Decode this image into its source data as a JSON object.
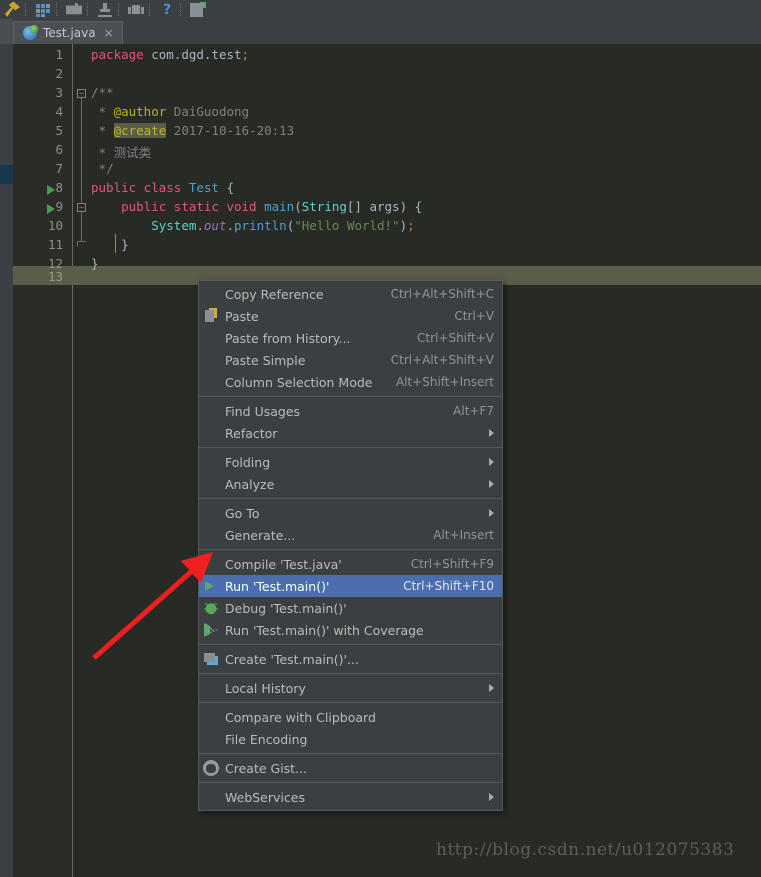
{
  "window": {
    "background_color": "#282a26",
    "chrome_color": "#3c4043"
  },
  "toolbar": {
    "icons": [
      {
        "name": "build-hammer-icon",
        "label": "Build"
      },
      {
        "name": "app-grid-icon",
        "label": "Android Resources"
      },
      {
        "name": "sync-gradle-icon",
        "label": "Sync Project"
      },
      {
        "name": "sdk-download-icon",
        "label": "SDK Manager"
      },
      {
        "name": "avd-manager-icon",
        "label": "AVD Manager"
      },
      {
        "name": "help-icon",
        "label": "Help"
      },
      {
        "name": "save-all-icon",
        "label": "Save All"
      }
    ]
  },
  "tab": {
    "icon": "java-class-icon",
    "label": "Test.java",
    "close": "×"
  },
  "editor": {
    "lines": [
      {
        "num": "1",
        "tokens": [
          {
            "t": "package",
            "c": "kw-pink"
          },
          {
            "t": " com.dgd.test",
            "c": "punct"
          },
          {
            "t": ";",
            "c": "semi"
          }
        ]
      },
      {
        "num": "2",
        "tokens": []
      },
      {
        "num": "3",
        "tokens": [
          {
            "t": "/**",
            "c": "cmt"
          }
        ]
      },
      {
        "num": "4",
        "tokens": [
          {
            "t": " * ",
            "c": "cmt"
          },
          {
            "t": "@author",
            "c": "anno"
          },
          {
            "t": " DaiGuodong",
            "c": "cmt"
          }
        ]
      },
      {
        "num": "5",
        "tokens": [
          {
            "t": " * ",
            "c": "cmt"
          },
          {
            "t": "@create",
            "c": "anno-hl"
          },
          {
            "t": " 2017-10-16-20:13",
            "c": "cmt"
          }
        ]
      },
      {
        "num": "6",
        "tokens": [
          {
            "t": " * 测试类",
            "c": "cmt"
          }
        ]
      },
      {
        "num": "7",
        "tokens": [
          {
            "t": " */",
            "c": "cmt"
          }
        ]
      },
      {
        "num": "8",
        "tokens": [
          {
            "t": "public class ",
            "c": "kw-pink"
          },
          {
            "t": "Test",
            "c": "type-blue"
          },
          {
            "t": " {",
            "c": "punct"
          }
        ]
      },
      {
        "num": "9",
        "tokens": [
          {
            "t": "    ",
            "c": "punct"
          },
          {
            "t": "public static void ",
            "c": "kw-pink"
          },
          {
            "t": "main",
            "c": "type-blue"
          },
          {
            "t": "(",
            "c": "punct"
          },
          {
            "t": "String",
            "c": "cls"
          },
          {
            "t": "[] args) {",
            "c": "punct"
          }
        ]
      },
      {
        "num": "10",
        "tokens": [
          {
            "t": "        ",
            "c": "punct"
          },
          {
            "t": "System",
            "c": "cls"
          },
          {
            "t": ".",
            "c": "punct"
          },
          {
            "t": "out",
            "c": "fld-italic"
          },
          {
            "t": ".",
            "c": "punct"
          },
          {
            "t": "println",
            "c": "type-blue"
          },
          {
            "t": "(",
            "c": "punct"
          },
          {
            "t": "\"Hello World!\"",
            "c": "str"
          },
          {
            "t": ")",
            "c": "punct"
          },
          {
            "t": ";",
            "c": "semi"
          }
        ]
      },
      {
        "num": "11",
        "tokens": [
          {
            "t": "    }",
            "c": "punct"
          }
        ]
      },
      {
        "num": "12",
        "tokens": [
          {
            "t": "}",
            "c": "punct"
          }
        ]
      },
      {
        "num": "13",
        "tokens": [],
        "caret": true
      }
    ],
    "run_markers_on_lines": [
      "8",
      "9"
    ]
  },
  "context_menu": {
    "items": [
      {
        "name": "copy-reference",
        "label": "Copy Reference",
        "accel": "Ctrl+Alt+Shift+C",
        "icon": null,
        "arrow": false,
        "selected": false
      },
      {
        "name": "paste",
        "label": "Paste",
        "accel": "Ctrl+V",
        "icon": "paste-icon",
        "arrow": false,
        "selected": false
      },
      {
        "name": "paste-from-history",
        "label": "Paste from History...",
        "accel": "Ctrl+Shift+V",
        "icon": null,
        "arrow": false,
        "selected": false
      },
      {
        "name": "paste-simple",
        "label": "Paste Simple",
        "accel": "Ctrl+Alt+Shift+V",
        "icon": null,
        "arrow": false,
        "selected": false
      },
      {
        "name": "column-selection-mode",
        "label": "Column Selection Mode",
        "accel": "Alt+Shift+Insert",
        "icon": null,
        "arrow": false,
        "selected": false
      },
      {
        "separator": true
      },
      {
        "name": "find-usages",
        "label": "Find Usages",
        "accel": "Alt+F7",
        "icon": null,
        "arrow": false,
        "selected": false
      },
      {
        "name": "refactor",
        "label": "Refactor",
        "accel": "",
        "icon": null,
        "arrow": true,
        "selected": false
      },
      {
        "separator": true
      },
      {
        "name": "folding",
        "label": "Folding",
        "accel": "",
        "icon": null,
        "arrow": true,
        "selected": false
      },
      {
        "name": "analyze",
        "label": "Analyze",
        "accel": "",
        "icon": null,
        "arrow": true,
        "selected": false
      },
      {
        "separator": true
      },
      {
        "name": "go-to",
        "label": "Go To",
        "accel": "",
        "icon": null,
        "arrow": true,
        "selected": false
      },
      {
        "name": "generate",
        "label": "Generate...",
        "accel": "Alt+Insert",
        "icon": null,
        "arrow": false,
        "selected": false
      },
      {
        "separator": true
      },
      {
        "name": "compile-test-java",
        "label": "Compile 'Test.java'",
        "accel": "Ctrl+Shift+F9",
        "icon": null,
        "arrow": false,
        "selected": false
      },
      {
        "name": "run-test-main",
        "label": "Run 'Test.main()'",
        "accel": "Ctrl+Shift+F10",
        "icon": "run-icon",
        "arrow": false,
        "selected": true
      },
      {
        "name": "debug-test-main",
        "label": "Debug 'Test.main()'",
        "accel": "",
        "icon": "debug-icon",
        "arrow": false,
        "selected": false
      },
      {
        "name": "run-test-main-with-coverage",
        "label": "Run 'Test.main()' with Coverage",
        "accel": "",
        "icon": "coverage-icon",
        "arrow": false,
        "selected": false
      },
      {
        "separator": true
      },
      {
        "name": "create-test-main-config",
        "label": "Create 'Test.main()'...",
        "accel": "",
        "icon": "create-config-icon",
        "arrow": false,
        "selected": false
      },
      {
        "separator": true
      },
      {
        "name": "local-history",
        "label": "Local History",
        "accel": "",
        "icon": null,
        "arrow": true,
        "selected": false
      },
      {
        "separator": true
      },
      {
        "name": "compare-with-clipboard",
        "label": "Compare with Clipboard",
        "accel": "",
        "icon": null,
        "arrow": false,
        "selected": false
      },
      {
        "name": "file-encoding",
        "label": "File Encoding",
        "accel": "",
        "icon": null,
        "arrow": false,
        "selected": false
      },
      {
        "separator": true
      },
      {
        "name": "create-gist",
        "label": "Create Gist...",
        "accel": "",
        "icon": "github-gist-icon",
        "arrow": false,
        "selected": false
      },
      {
        "separator": true
      },
      {
        "name": "web-services",
        "label": "WebServices",
        "accel": "",
        "icon": null,
        "arrow": true,
        "selected": false
      }
    ],
    "selection_color": "#4b6eaf"
  },
  "annotation": {
    "arrow_color": "#f02020",
    "name": "red-pointer-arrow"
  },
  "watermark": {
    "text": "http://blog.csdn.net/u012075383"
  }
}
